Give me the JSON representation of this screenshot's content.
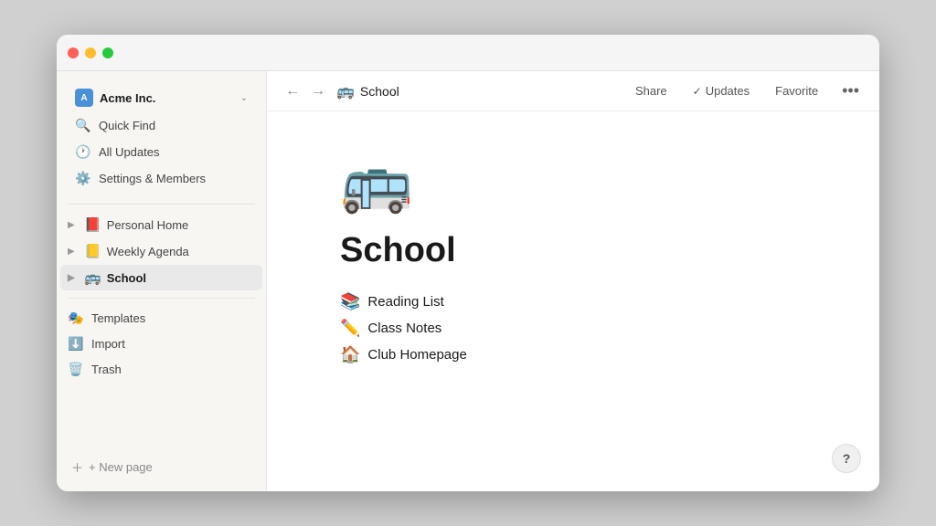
{
  "window": {
    "title": "School"
  },
  "sidebar": {
    "workspace": {
      "name": "Acme Inc.",
      "chevron": "⌄"
    },
    "nav_items": [
      {
        "id": "quick-find",
        "icon": "🔍",
        "label": "Quick Find"
      },
      {
        "id": "all-updates",
        "icon": "🕐",
        "label": "All Updates"
      },
      {
        "id": "settings",
        "icon": "⚙️",
        "label": "Settings & Members"
      }
    ],
    "pages": [
      {
        "id": "personal-home",
        "emoji": "📕",
        "label": "Personal Home",
        "active": false
      },
      {
        "id": "weekly-agenda",
        "emoji": "📒",
        "label": "Weekly Agenda",
        "active": false
      },
      {
        "id": "school",
        "emoji": "🚌",
        "label": "School",
        "active": true
      }
    ],
    "bottom_items": [
      {
        "id": "templates",
        "icon": "🎭",
        "label": "Templates"
      },
      {
        "id": "import",
        "icon": "⬇️",
        "label": "Import"
      },
      {
        "id": "trash",
        "icon": "🗑️",
        "label": "Trash"
      }
    ],
    "new_page_label": "+ New page",
    "collapse_icon": "《"
  },
  "topbar": {
    "page_emoji": "🚌",
    "page_title": "School",
    "share_label": "Share",
    "updates_check": "✓",
    "updates_label": "Updates",
    "favorite_label": "Favorite",
    "more_icon": "•••"
  },
  "page": {
    "icon": "🚌",
    "heading": "School",
    "subpages": [
      {
        "id": "reading-list",
        "emoji": "📚",
        "label": "Reading List"
      },
      {
        "id": "class-notes",
        "emoji": "✏️",
        "label": "Class Notes"
      },
      {
        "id": "club-homepage",
        "emoji": "🏠",
        "label": "Club Homepage"
      }
    ]
  },
  "help": {
    "label": "?"
  }
}
